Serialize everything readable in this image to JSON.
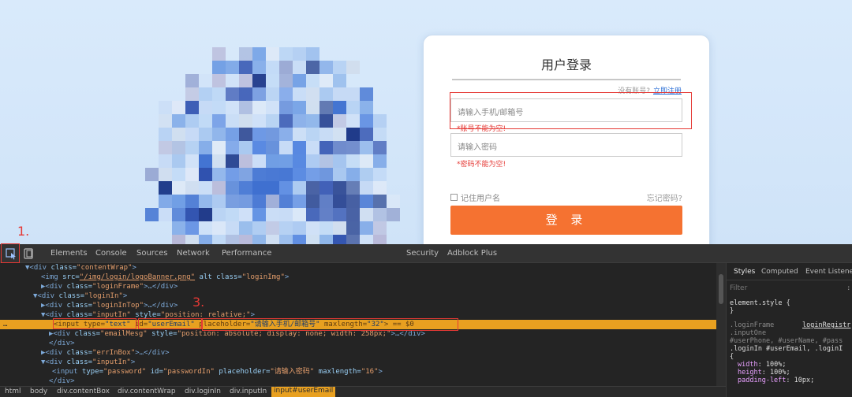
{
  "login": {
    "title": "用户登录",
    "no_account": "没有账号?",
    "register_link": "立即注册",
    "email_placeholder": "请输入手机/邮箱号",
    "email_error": "*账号不能为空!",
    "password_placeholder": "请输入密码",
    "password_error": "*密码不能为空!",
    "remember_label": "记住用户名",
    "forgot_label": "忘记密码?",
    "submit_label": "登 录",
    "accent": "#f57231"
  },
  "annotations": {
    "step1": "1.",
    "step2": "2.",
    "step3": "3."
  },
  "devtools": {
    "tabs": [
      "Elements",
      "Console",
      "Sources",
      "Network",
      "Performance",
      "Security",
      "Adblock Plus"
    ],
    "active_tab": "Elements",
    "dom": [
      {
        "p": "▼<",
        "t": "div",
        "a": " class=",
        "v": "\"contentWrap\"",
        "e": ">"
      },
      {
        "p": "<",
        "t": "img",
        "a": " src=",
        "v": "\"/img/login/logoBanner.png\"",
        "a2": " alt class=",
        "v2": "\"loginImg\"",
        "e": ">"
      },
      {
        "p": "▶<",
        "t": "div",
        "a": " class=",
        "v": "\"loginFrame\"",
        "e": ">…</div>"
      },
      {
        "p": "▼<",
        "t": "div",
        "a": " class=",
        "v": "\"loginIn\"",
        "e": ">"
      },
      {
        "p": "▶<",
        "t": "div",
        "a": " class=",
        "v": "\"loginInTop\"",
        "e": ">…</div>"
      },
      {
        "p": "▼<",
        "t": "div",
        "a": " class=",
        "v": "\"inputIn\"",
        "a2": " style=",
        "v2": "\"position: relative;\"",
        "e": ">"
      },
      {
        "p": "<",
        "t": "input",
        "a": " type=",
        "v": "\"text\"",
        "a2": " id=",
        "v2": "\"userEmail\"",
        "a3": " placeholder=",
        "v3": "\"请输入手机/邮箱号\"",
        "a4": " maxlength=",
        "v4": "\"32\"",
        "e": "> == $0"
      },
      {
        "p": "▶<",
        "t": "div",
        "a": " class=",
        "v": "\"emailMesg\"",
        "a2": " style=",
        "v2": "\"position: absolute; display: none; width: 258px;\"",
        "e": ">…</div>"
      },
      {
        "p": "</",
        "t": "div",
        "e": ">"
      },
      {
        "p": "▶<",
        "t": "div",
        "a": " class=",
        "v": "\"errInBox\"",
        "e": ">…</div>"
      },
      {
        "p": "▼<",
        "t": "div",
        "a": " class=",
        "v": "\"inputIn\"",
        "e": ">"
      },
      {
        "p": "<",
        "t": "input",
        "a": " type=",
        "v": "\"password\"",
        "a2": " id=",
        "v2": "\"passwordIn\"",
        "a3": " placeholder=",
        "v3": "\"请输入密码\"",
        "a4": " maxlength=",
        "v4": "\"16\"",
        "e": ">"
      },
      {
        "p": "</",
        "t": "div",
        "e": ">"
      }
    ],
    "breadcrumbs": [
      "html",
      "body",
      "div.contentBox",
      "div.contentWrap",
      "div.loginIn",
      "div.inputIn",
      "input#userEmail"
    ],
    "styles": {
      "tabs": [
        "Styles",
        "Computed",
        "Event Listeners"
      ],
      "filter_placeholder": "Filter",
      "filter_suffix": ":",
      "element_style": "element.style {",
      "close_brace": "}",
      "rule_selector_1": ".loginFrame",
      "rule_source": "loginRegistr",
      "rule_selector_2": ".inputOne",
      "rule_selector_3": "#userPhone, #userName, #pass",
      "rule_selector_4": ".loginIn #userEmail, .loginI",
      "open_brace": "{",
      "props": [
        {
          "k": "width",
          "v": "100%;"
        },
        {
          "k": "height",
          "v": "100%;"
        },
        {
          "k": "padding-left",
          "v": "10px;"
        }
      ]
    }
  }
}
